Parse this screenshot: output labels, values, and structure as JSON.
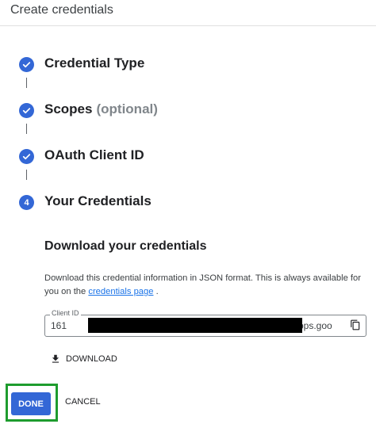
{
  "header": {
    "title": "Create credentials"
  },
  "steps": [
    {
      "label": "Credential Type",
      "optional": "",
      "state": "done",
      "icon": "check-icon"
    },
    {
      "label": "Scopes",
      "optional": "(optional)",
      "state": "done",
      "icon": "check-icon"
    },
    {
      "label": "OAuth Client ID",
      "optional": "",
      "state": "done",
      "icon": "check-icon"
    },
    {
      "label": "Your Credentials",
      "optional": "",
      "state": "current",
      "number": "4"
    }
  ],
  "download_section": {
    "heading": "Download your credentials",
    "description_prefix": "Download this credential information in JSON format. This is always available for you on the ",
    "link_text": "credentials page",
    "description_suffix": ".",
    "client_id_label": "Client ID",
    "client_id_prefix": "161",
    "client_id_suffix": "pps.goo",
    "download_label": "DOWNLOAD"
  },
  "actions": {
    "done_label": "DONE",
    "cancel_label": "CANCEL"
  },
  "colors": {
    "accent": "#3367d6",
    "highlight_outline": "#1e9c2e",
    "link": "#1a73e8"
  },
  "icons": {
    "copy": "copy-icon",
    "download": "download-icon",
    "check": "check-icon"
  }
}
